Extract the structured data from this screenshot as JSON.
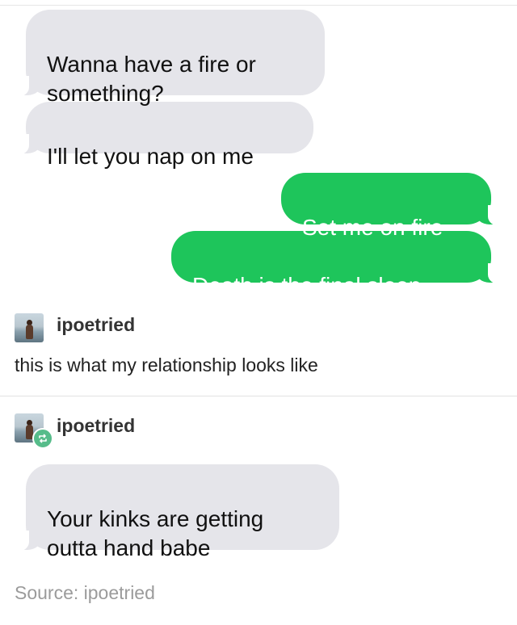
{
  "screenshot": {
    "messages": [
      {
        "side": "received",
        "text": "Wanna have a fire or\nsomething?"
      },
      {
        "side": "received",
        "text": "I'll let you nap on me"
      },
      {
        "side": "sent",
        "text": "Set me on fire"
      },
      {
        "side": "sent",
        "text": "Death is the final sleep"
      }
    ]
  },
  "post": {
    "username": "ipoetried",
    "caption": "this is what my relationship looks like"
  },
  "reblog": {
    "username": "ipoetried",
    "reply": {
      "side": "received",
      "text": "Your kinks are getting\noutta hand babe"
    }
  },
  "source": {
    "text": "Source: ipoetried"
  },
  "colors": {
    "received_bubble": "#e5e5ea",
    "sent_bubble": "#1ec55b",
    "reblog_badge": "#56bc8a",
    "source_text": "#9b9b9b"
  },
  "icons": {
    "reblog": "reblog-icon",
    "avatar": "avatar"
  }
}
